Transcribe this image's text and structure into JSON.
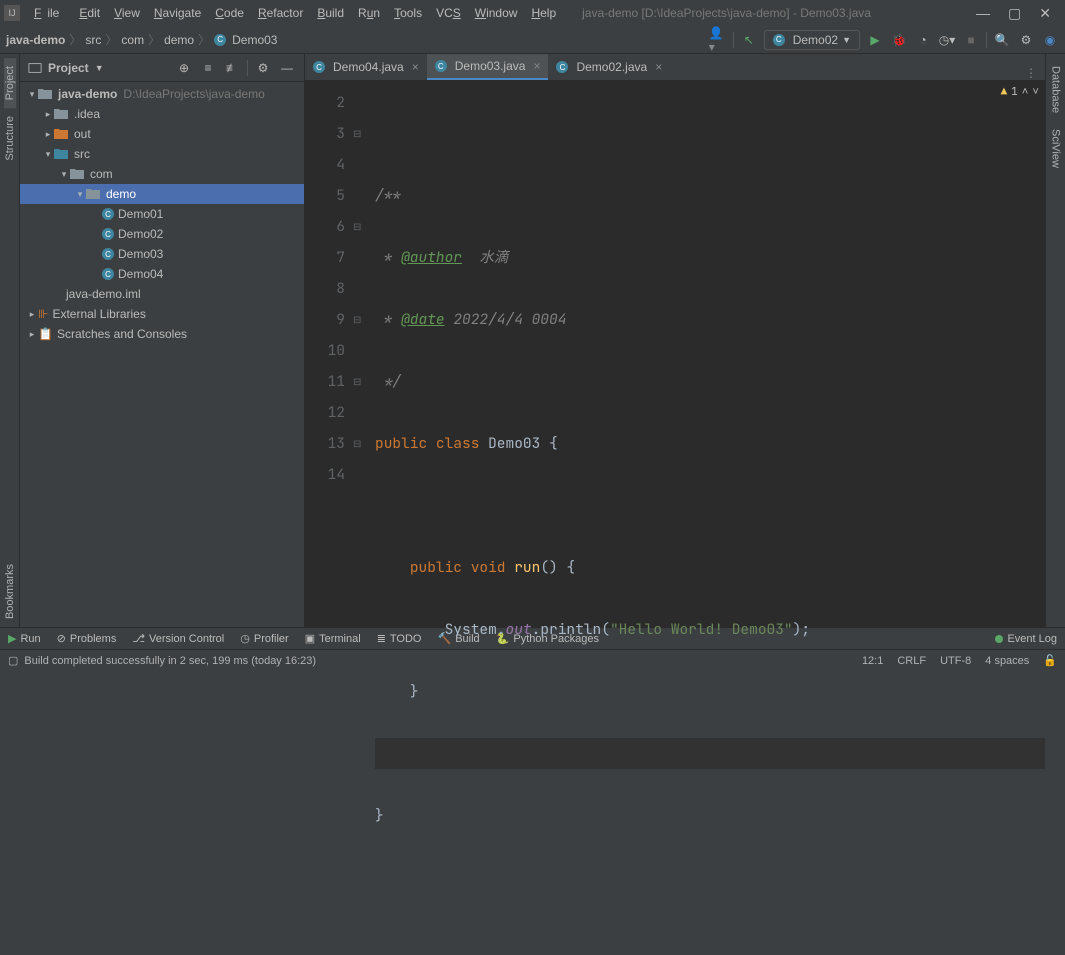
{
  "window": {
    "title": "java-demo [D:\\IdeaProjects\\java-demo] - Demo03.java"
  },
  "menu": {
    "file": "File",
    "edit": "Edit",
    "view": "View",
    "navigate": "Navigate",
    "code": "Code",
    "refactor": "Refactor",
    "build": "Build",
    "run": "Run",
    "tools": "Tools",
    "vcs": "VCS",
    "window": "Window",
    "help": "Help"
  },
  "breadcrumb": [
    "java-demo",
    "src",
    "com",
    "demo",
    "Demo03"
  ],
  "run_config": "Demo02",
  "sidebars": {
    "project": "Project",
    "structure": "Structure",
    "bookmarks": "Bookmarks",
    "database": "Database",
    "sciview": "SciView"
  },
  "project_panel": {
    "title": "Project",
    "tree": {
      "root": {
        "name": "java-demo",
        "path": "D:\\IdeaProjects\\java-demo"
      },
      "idea": ".idea",
      "out": "out",
      "src": "src",
      "com": "com",
      "demo": "demo",
      "files": [
        "Demo01",
        "Demo02",
        "Demo03",
        "Demo04"
      ],
      "iml": "java-demo.iml",
      "ext": "External Libraries",
      "scratch": "Scratches and Consoles"
    }
  },
  "tabs": [
    {
      "label": "Demo04.java",
      "active": false
    },
    {
      "label": "Demo03.java",
      "active": true
    },
    {
      "label": "Demo02.java",
      "active": false
    }
  ],
  "warnings": "1",
  "code": {
    "line_start": 2,
    "author_tag": "@author",
    "author_val": "水滴",
    "date_tag": "@date",
    "date_val": "2022/4/4 0004",
    "class_name": "Demo03",
    "method_name": "run",
    "string_literal": "\"Hello World! Demo03\""
  },
  "toolwindows": {
    "run": "Run",
    "problems": "Problems",
    "vcs": "Version Control",
    "profiler": "Profiler",
    "terminal": "Terminal",
    "todo": "TODO",
    "build": "Build",
    "python": "Python Packages",
    "eventlog": "Event Log"
  },
  "status": {
    "message": "Build completed successfully in 2 sec, 199 ms (today 16:23)",
    "pos": "12:1",
    "eol": "CRLF",
    "enc": "UTF-8",
    "indent": "4 spaces"
  }
}
